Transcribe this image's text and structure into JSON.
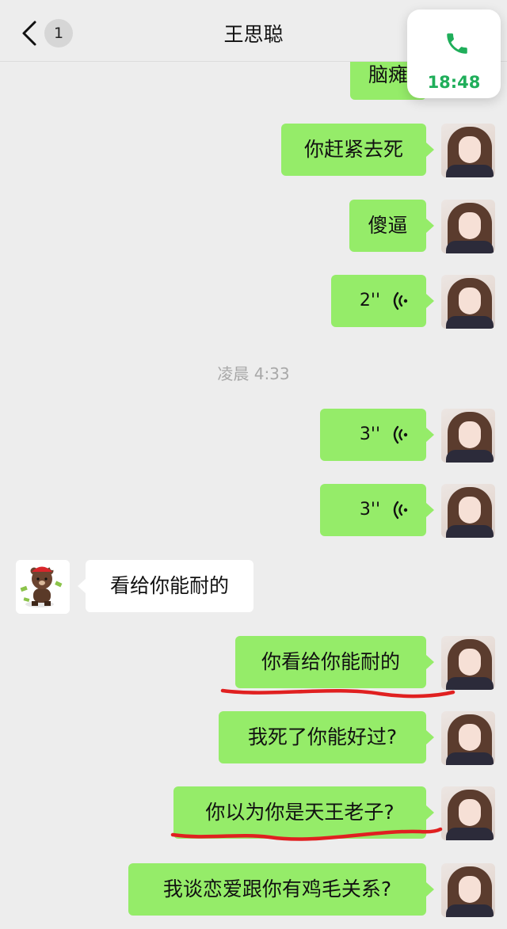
{
  "header": {
    "back_count": "1",
    "contact_name": "王思聪"
  },
  "call_float": {
    "time": "18:48",
    "icon": "phone-icon"
  },
  "timestamp": "凌晨 4:33",
  "messages": {
    "m0": {
      "text": "脑瘫"
    },
    "m1": {
      "text": "你赶紧去死"
    },
    "m2": {
      "text": "傻逼"
    },
    "m3": {
      "duration": "2''"
    },
    "m4": {
      "duration": "3''"
    },
    "m5": {
      "duration": "3''"
    },
    "m6": {
      "text": "看给你能耐的"
    },
    "m7": {
      "text": "你看给你能耐的"
    },
    "m8": {
      "text": "我死了你能好过?"
    },
    "m9": {
      "text": "你以为你是天王老子?"
    },
    "m10": {
      "text": "我谈恋爱跟你有鸡毛关系?"
    }
  },
  "colors": {
    "outgoing_bubble": "#95ec69",
    "incoming_bubble": "#ffffff",
    "background": "#ededed",
    "call_time": "#1fae5a",
    "annotation_underline": "#e02020"
  }
}
